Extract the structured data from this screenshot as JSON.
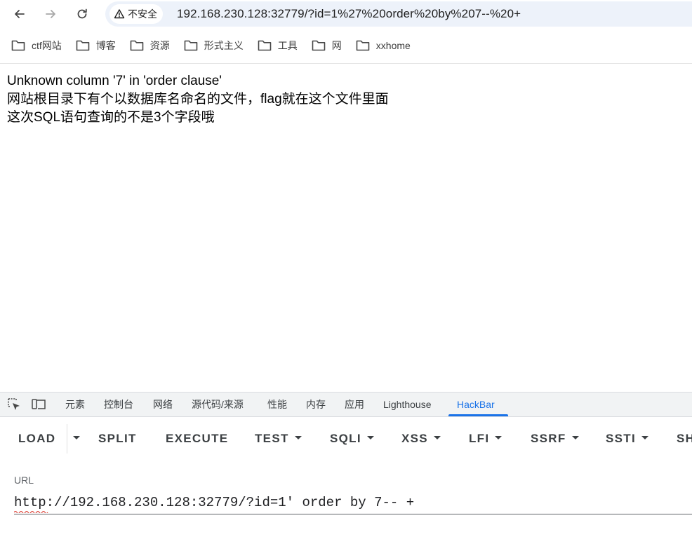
{
  "browser": {
    "security_label": "不安全",
    "address_bar_url": "192.168.230.128:32779/?id=1%27%20order%20by%207--%20+",
    "icons": {
      "back": "back-arrow-icon",
      "forward": "forward-arrow-icon",
      "reload": "reload-icon",
      "warning": "warning-triangle-icon"
    }
  },
  "bookmarks": [
    {
      "label": "ctf网站",
      "icon": "folder-icon"
    },
    {
      "label": "博客",
      "icon": "folder-icon"
    },
    {
      "label": "资源",
      "icon": "folder-icon"
    },
    {
      "label": "形式主义",
      "icon": "folder-icon"
    },
    {
      "label": "工具",
      "icon": "folder-icon"
    },
    {
      "label": "网",
      "icon": "folder-icon"
    },
    {
      "label": "xxhome",
      "icon": "folder-icon"
    }
  ],
  "page": {
    "lines": [
      "Unknown column '7' in 'order clause'",
      "网站根目录下有个以数据库名命名的文件，flag就在这个文件里面",
      "这次SQL语句查询的不是3个字段哦"
    ]
  },
  "devtools": {
    "tabs": [
      "元素",
      "控制台",
      "网络",
      "源代码/来源",
      "性能",
      "内存",
      "应用",
      "Lighthouse",
      "HackBar"
    ],
    "active_tab": "HackBar",
    "accent_color": "#1a73e8",
    "icons": [
      "inspect-element-icon",
      "device-toolbar-icon"
    ]
  },
  "hackbar": {
    "buttons": [
      {
        "label": "LOAD",
        "dropdown": false
      },
      {
        "label": "",
        "dropdown": true
      },
      {
        "label": "SPLIT",
        "dropdown": false
      },
      {
        "label": "EXECUTE",
        "dropdown": false
      },
      {
        "label": "TEST",
        "dropdown": true
      },
      {
        "label": "SQLI",
        "dropdown": true
      },
      {
        "label": "XSS",
        "dropdown": true
      },
      {
        "label": "LFI",
        "dropdown": true
      },
      {
        "label": "SSRF",
        "dropdown": true
      },
      {
        "label": "SSTI",
        "dropdown": true
      },
      {
        "label": "SH",
        "dropdown": false
      }
    ],
    "url_label": "URL",
    "url_value": "http://192.168.230.128:32779/?id=1' order by 7-- +"
  }
}
